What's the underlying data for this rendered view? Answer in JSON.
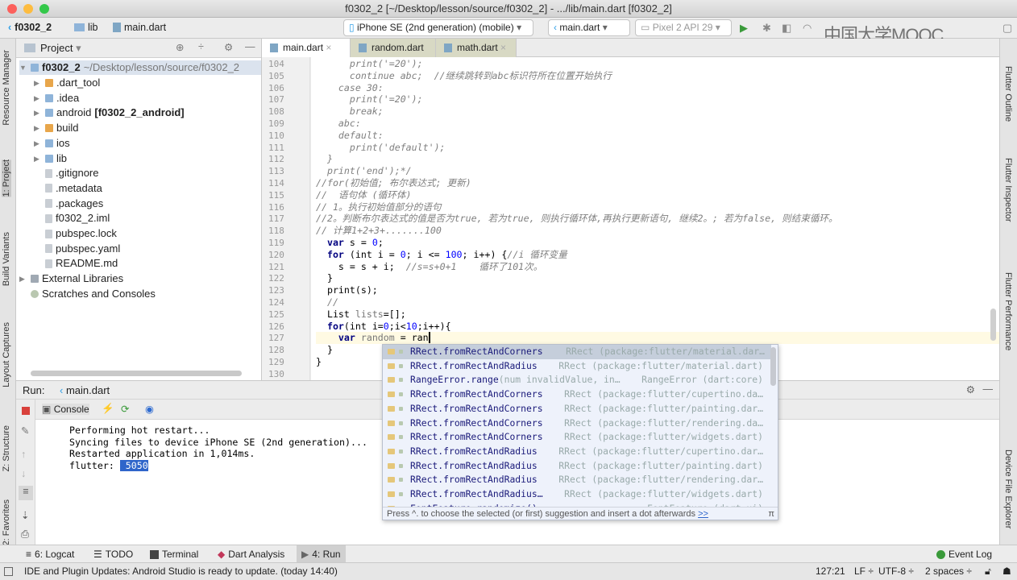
{
  "window": {
    "title": "f0302_2 [~/Desktop/lesson/source/f0302_2] - .../lib/main.dart [f0302_2]"
  },
  "nav": {
    "project": "f0302_2",
    "folder": "lib",
    "file": "main.dart",
    "device": "iPhone SE (2nd generation) (mobile)",
    "run_config": "main.dart",
    "emulator": "Pixel 2 API 29",
    "watermark": "中国大学MOOC"
  },
  "left_strip": [
    "Resource Manager",
    "1: Project",
    "Build Variants",
    "Layout Captures",
    "Z: Structure",
    "2: Favorites"
  ],
  "right_strip": [
    "Flutter Outline",
    "Flutter Inspector",
    "Flutter Performance",
    "Device File Explorer"
  ],
  "project": {
    "header": "Project",
    "root": "f0302_2",
    "root_path": "~/Desktop/lesson/source/f0302_2",
    "items": [
      {
        "label": ".dart_tool",
        "type": "folder-excluded",
        "expand": true
      },
      {
        "label": ".idea",
        "type": "folder",
        "expand": true
      },
      {
        "label": "android",
        "suffix": "[f0302_2_android]",
        "type": "folder",
        "expand": true
      },
      {
        "label": "build",
        "type": "folder-excluded",
        "expand": true
      },
      {
        "label": "ios",
        "type": "folder",
        "expand": true
      },
      {
        "label": "lib",
        "type": "folder",
        "expand": true
      },
      {
        "label": ".gitignore",
        "type": "file"
      },
      {
        "label": ".metadata",
        "type": "file"
      },
      {
        "label": ".packages",
        "type": "file"
      },
      {
        "label": "f0302_2.iml",
        "type": "file"
      },
      {
        "label": "pubspec.lock",
        "type": "file"
      },
      {
        "label": "pubspec.yaml",
        "type": "file"
      },
      {
        "label": "README.md",
        "type": "file"
      }
    ],
    "external": "External Libraries",
    "scratches": "Scratches and Consoles"
  },
  "editor": {
    "tabs": [
      "main.dart",
      "random.dart",
      "math.dart"
    ],
    "active_tab": 0,
    "lines": [
      {
        "n": "104",
        "seg": [
          [
            "cm",
            "      print('=20');"
          ]
        ]
      },
      {
        "n": "105",
        "seg": [
          [
            "cm",
            "      continue abc;  //继续跳转到abc标识符所在位置开始执行"
          ]
        ]
      },
      {
        "n": "106",
        "seg": [
          [
            "cm",
            "    case 30:"
          ]
        ]
      },
      {
        "n": "107",
        "seg": [
          [
            "cm",
            "      print('=20');"
          ]
        ]
      },
      {
        "n": "108",
        "seg": [
          [
            "cm",
            "      break;"
          ]
        ]
      },
      {
        "n": "109",
        "seg": [
          [
            "cm",
            "    abc:"
          ]
        ]
      },
      {
        "n": "110",
        "seg": [
          [
            "cm",
            "    default:"
          ]
        ]
      },
      {
        "n": "111",
        "seg": [
          [
            "cm",
            "      print('default');"
          ]
        ]
      },
      {
        "n": "112",
        "seg": [
          [
            "cm",
            "  }"
          ]
        ]
      },
      {
        "n": "113",
        "seg": [
          [
            "cm",
            "  print('end');*/"
          ]
        ]
      },
      {
        "n": "114",
        "seg": [
          [
            "cm",
            "//for(初始值; 布尔表达式; 更新)"
          ]
        ]
      },
      {
        "n": "115",
        "seg": [
          [
            "cm",
            "//  语句体 (循环体)"
          ]
        ]
      },
      {
        "n": "116",
        "seg": [
          [
            "cm",
            "// 1。执行初始值部分的语句"
          ]
        ]
      },
      {
        "n": "117",
        "seg": [
          [
            "cm",
            "//2。判断布尔表达式的值是否为true, 若为true, 则执行循环体,再执行更新语句, 继续2。; 若为false, 则结束循环。"
          ]
        ]
      },
      {
        "n": "118",
        "seg": [
          [
            "cm",
            "// 计算1+2+3+.......100"
          ]
        ]
      },
      {
        "n": "119",
        "seg": [
          [
            "tx",
            "  "
          ],
          [
            "kw",
            "var"
          ],
          [
            "tx",
            " s = "
          ],
          [
            "num",
            "0"
          ],
          [
            "tx",
            ";"
          ]
        ]
      },
      {
        "n": "120",
        "seg": [
          [
            "tx",
            "  "
          ],
          [
            "kw",
            "for"
          ],
          [
            "tx",
            " (int i = "
          ],
          [
            "num",
            "0"
          ],
          [
            "tx",
            "; i <= "
          ],
          [
            "num",
            "100"
          ],
          [
            "tx",
            "; i++) {"
          ],
          [
            "cm",
            "//i 循环变量"
          ]
        ]
      },
      {
        "n": "121",
        "seg": [
          [
            "tx",
            "    s = s + i;  "
          ],
          [
            "cm",
            "//s=s+0+1    循环了101次。"
          ]
        ]
      },
      {
        "n": "122",
        "seg": [
          [
            "tx",
            "  }"
          ]
        ]
      },
      {
        "n": "123",
        "seg": [
          [
            "tx",
            "  print(s);"
          ]
        ]
      },
      {
        "n": "124",
        "seg": [
          [
            "cm",
            "  //"
          ]
        ]
      },
      {
        "n": "125",
        "seg": [
          [
            "tx",
            "  List "
          ],
          [
            "dim",
            "lists"
          ],
          [
            "tx",
            "=[];"
          ]
        ]
      },
      {
        "n": "126",
        "seg": [
          [
            "tx",
            "  "
          ],
          [
            "kw",
            "for"
          ],
          [
            "tx",
            "(int i="
          ],
          [
            "num",
            "0"
          ],
          [
            "tx",
            ";i<"
          ],
          [
            "num",
            "10"
          ],
          [
            "tx",
            ";i++){"
          ]
        ]
      },
      {
        "n": "127",
        "seg": [
          [
            "tx",
            "    "
          ],
          [
            "kw",
            "var"
          ],
          [
            "dim",
            " random"
          ],
          [
            "tx",
            " = ran"
          ]
        ]
      },
      {
        "n": "128",
        "seg": [
          [
            "tx",
            "  }"
          ]
        ]
      },
      {
        "n": "129",
        "seg": [
          [
            "tx",
            "}"
          ]
        ]
      },
      {
        "n": "130",
        "seg": []
      }
    ]
  },
  "autocomplete": {
    "items": [
      {
        "name": "RRect.fromRectAndCorners",
        "type": "RRect (package:flutter/material.dar…"
      },
      {
        "name": "RRect.fromRectAndRadius",
        "type": "RRect (package:flutter/material.dart)"
      },
      {
        "name": "RangeError.range",
        "params": "(num invalidValue, in…",
        "type": "RangeError (dart:core)"
      },
      {
        "name": "RRect.fromRectAndCorners",
        "type": "RRect (package:flutter/cupertino.da…"
      },
      {
        "name": "RRect.fromRectAndCorners",
        "type": "RRect (package:flutter/painting.dar…"
      },
      {
        "name": "RRect.fromRectAndCorners",
        "type": "RRect (package:flutter/rendering.da…"
      },
      {
        "name": "RRect.fromRectAndCorners",
        "type": "RRect (package:flutter/widgets.dart)"
      },
      {
        "name": "RRect.fromRectAndRadius",
        "type": "RRect (package:flutter/cupertino.dar…"
      },
      {
        "name": "RRect.fromRectAndRadius",
        "type": "RRect (package:flutter/painting.dart)"
      },
      {
        "name": "RRect.fromRectAndRadius",
        "type": "RRect (package:flutter/rendering.dar…"
      },
      {
        "name": "RRect.fromRectAndRadius…",
        "type": "RRect (package:flutter/widgets.dart)"
      },
      {
        "name": "FontFeature.randomize()",
        "type": "FontFeature (dart:ui)"
      }
    ],
    "footer": "Press ^. to choose the selected (or first) suggestion and insert a dot afterwards",
    "footer_link": ">>",
    "pi": "π"
  },
  "run": {
    "label": "Run:",
    "config": "main.dart",
    "console_tab": "Console",
    "output": [
      "Performing hot restart...",
      "Syncing files to device iPhone SE (2nd generation)...",
      "Restarted application in 1,014ms.",
      "flutter: "
    ],
    "selected": " 5050"
  },
  "bottom_tools": [
    "6: Logcat",
    "TODO",
    "Terminal",
    "Dart Analysis",
    "4: Run"
  ],
  "event_log": "Event Log",
  "status": {
    "message": "IDE and Plugin Updates: Android Studio is ready to update. (today 14:40)",
    "position": "127:21",
    "line_sep": "LF ÷",
    "encoding": "UTF-8 ÷",
    "indent": "2 spaces ÷"
  },
  "colors": {
    "flutter_blue": "#2e9ee6",
    "selection": "#2f65ca",
    "popup_bg": "#eef2fb",
    "folder": "#8fb4d9",
    "excluded_folder": "#e8a64b"
  }
}
